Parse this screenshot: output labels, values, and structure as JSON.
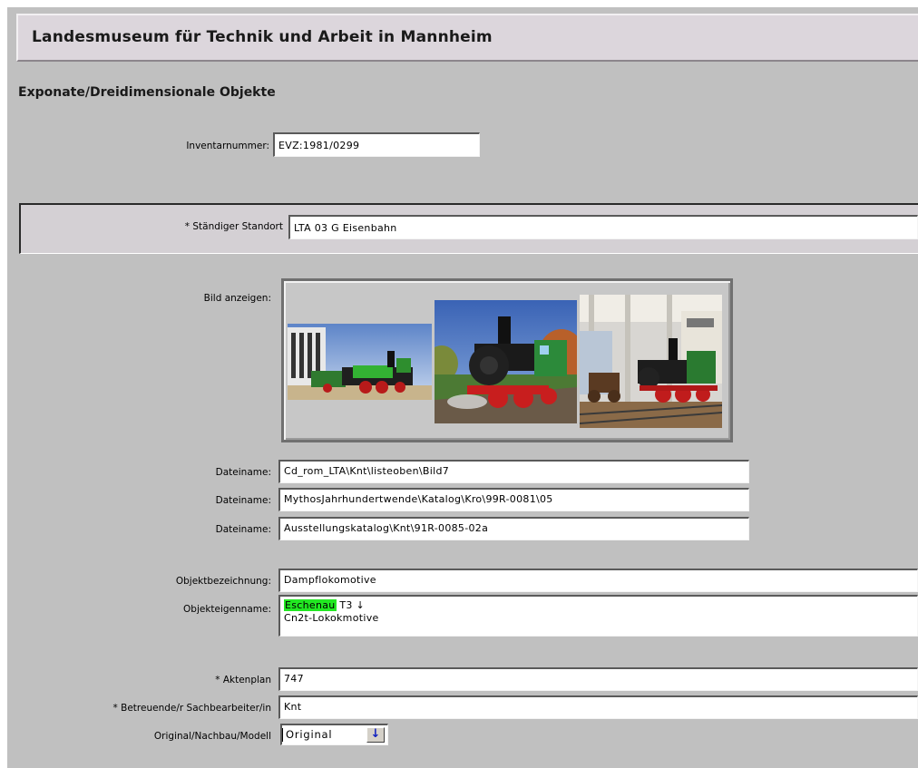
{
  "header": {
    "title": "Landesmuseum für Technik und Arbeit in Mannheim"
  },
  "section": {
    "heading": "Exponate/Dreidimensionale Objekte"
  },
  "fields": {
    "inventarnummer": {
      "label": "Inventarnummer:",
      "value": "EVZ:1981/0299"
    },
    "standort": {
      "label": "* Ständiger Standort",
      "value": "LTA 03 G   Eisenbahn"
    },
    "bild": {
      "label": "Bild anzeigen:",
      "images": [
        "green steam locomotive outside modern building",
        "green steam locomotive on grass",
        "green steam locomotive in museum hall"
      ]
    },
    "dateinamen": [
      {
        "label": "Dateiname:",
        "value": "Cd_rom_LTA\\Knt\\listeoben\\Bild7"
      },
      {
        "label": "Dateiname:",
        "value": "MythosJahrhundertwende\\Katalog\\Kro\\99R-0081\\05"
      },
      {
        "label": "Dateiname:",
        "value": "Ausstellungskatalog\\Knt\\91R-0085-02a"
      }
    ],
    "objektbezeichnung": {
      "label": "Objektbezeichnung:",
      "value": "Dampflokomotive"
    },
    "objekteigenname": {
      "label": "Objekteigenname:",
      "highlight": "Eschenau",
      "line1_rest": " T3 ↓",
      "line2": "Cn2t-Lokokmotive",
      "highlight_color": "#22e822"
    },
    "aktenplan": {
      "label": "* Aktenplan",
      "value": "747"
    },
    "sachbearbeiter": {
      "label": "* Betreuende/r Sachbearbeiter/in",
      "value": "Knt"
    },
    "original": {
      "label": "Original/Nachbau/Modell",
      "value": "Original",
      "arrow_icon": "down-arrow-icon"
    }
  }
}
